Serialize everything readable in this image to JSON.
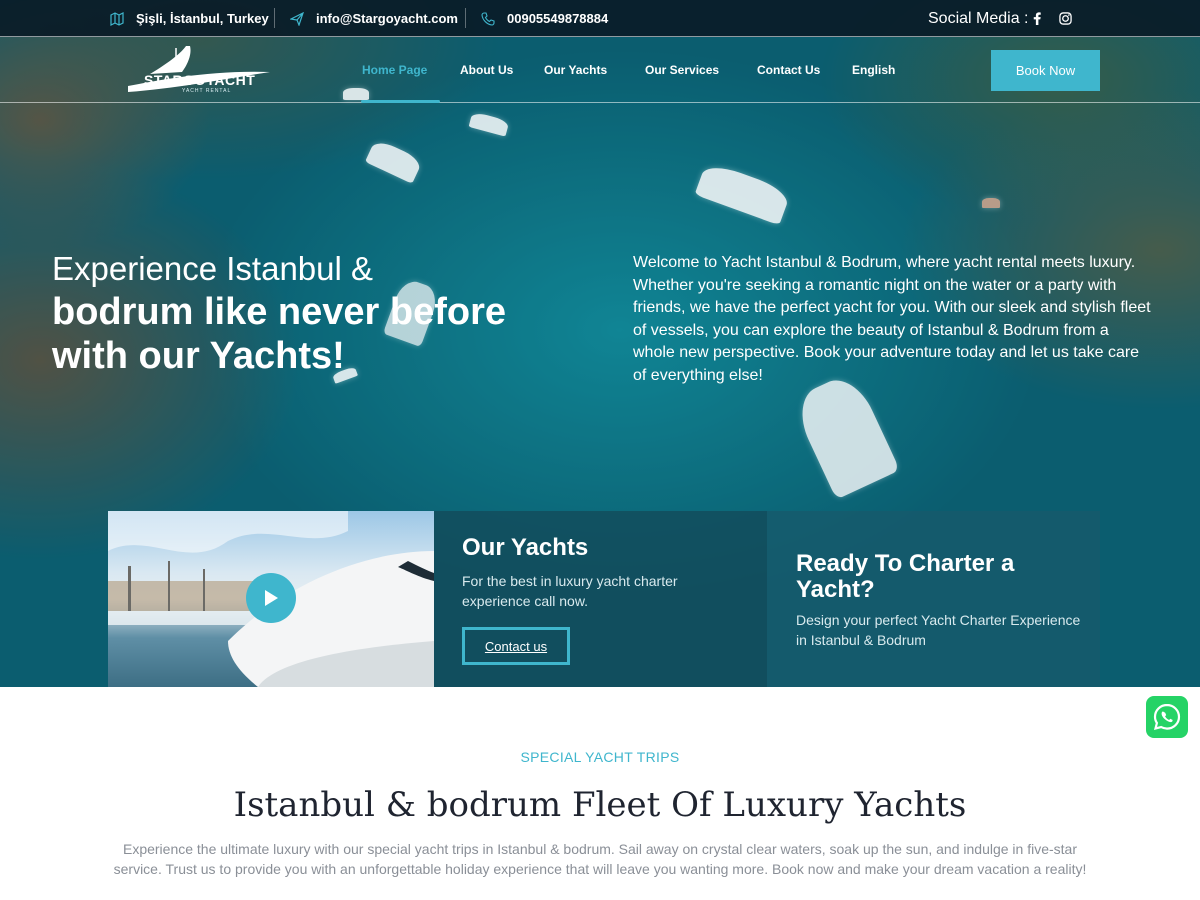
{
  "topbar": {
    "location": "Şişli, İstanbul, Turkey",
    "email": "info@Stargoyacht.com",
    "phone": "00905549878884",
    "social_label": "Social Media :",
    "social_icons": [
      "facebook-icon",
      "instagram-icon"
    ]
  },
  "brand": {
    "logo_text": "STARGOYACHT",
    "logo_subtext": "YACHT RENTAL"
  },
  "nav": {
    "items": [
      {
        "label": "Home Page",
        "active": true
      },
      {
        "label": "About Us",
        "active": false
      },
      {
        "label": "Our Yachts",
        "active": false
      },
      {
        "label": "Our Services",
        "active": false
      },
      {
        "label": "Contact Us",
        "active": false
      },
      {
        "label": "English",
        "active": false
      }
    ],
    "cta": "Book Now"
  },
  "hero": {
    "title_line1": "Experience Istanbul &",
    "title_line2": "bodrum like never before with our Yachts!",
    "description": "Welcome to Yacht Istanbul & Bodrum, where yacht rental meets luxury. Whether you're seeking a romantic night on the water or a party with friends, we have the perfect yacht for you. With our sleek and stylish fleet of vessels, you can explore the beauty of Istanbul & Bodrum from a whole new perspective. Book your adventure today and let us take care of everything else!"
  },
  "cards": {
    "yachts": {
      "title": "Our Yachts",
      "text": "For the best in luxury yacht charter experience call now.",
      "button": "Contact us"
    },
    "charter": {
      "title": "Ready To Charter a Yacht?",
      "text": "Design your perfect Yacht Charter Experience in Istanbul & Bodrum"
    }
  },
  "section": {
    "eyebrow": "SPECIAL YACHT TRIPS",
    "title": "Istanbul & bodrum Fleet Of Luxury Yachts",
    "description": "Experience the ultimate luxury with our special yacht trips in Istanbul & bodrum. Sail away on crystal clear waters, soak up the sun, and indulge in five-star service. Trust us to provide you with an unforgettable holiday experience that will leave you wanting more. Book now and make your dream vacation a reality!"
  },
  "colors": {
    "accent": "#3fb6cd",
    "topbar_bg": "#091a26",
    "title_dark": "#1f2430",
    "body_gray": "#8a8f97",
    "whatsapp": "#25d366"
  }
}
